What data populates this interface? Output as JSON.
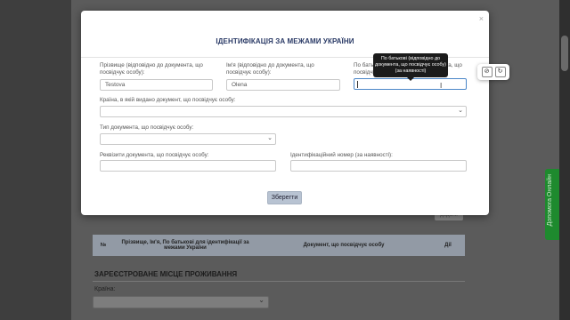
{
  "modal": {
    "title": "ІДЕНТИФІКАЦІЯ ЗА МЕЖАМИ УКРАЇНИ",
    "close_label": "×",
    "fields": {
      "surname": {
        "label": "Прізвище (відповідно до документа, що посвідчує особу):",
        "value": "Testova"
      },
      "name": {
        "label": "Ім'я (відповідно до документа, що посвідчує особу):",
        "value": "Olena"
      },
      "patronymic": {
        "label": "По батькові (відповідно до документа, що посвідчує особу):",
        "value": ""
      },
      "country": {
        "label": "Країна, в якій видано документ, що посвідчує особу:",
        "value": ""
      },
      "doc_type": {
        "label": "Тип документа, що посвідчує особу:",
        "value": ""
      },
      "doc_details": {
        "label": "Реквізити документа, що посвідчує особу:",
        "value": ""
      },
      "id_number": {
        "label": "Ідентифікаційний номер (за наявності):",
        "value": ""
      }
    },
    "save_label": "Зберегти"
  },
  "tooltip": {
    "line1": "По батькові (відповідно до",
    "line2": "документа, що посвідчує особу)",
    "line3": "(за наявності)"
  },
  "background": {
    "under_text": "— — — —  —  — — —",
    "under_button": "додати",
    "table": {
      "headers": [
        "№",
        "Прізвище, Ім'я, По батькові для ідентифікації за межами України",
        "Документ, що посвідчує особу",
        "Дії"
      ]
    },
    "section_title": "ЗАРЕЄСТРОВАНЕ МІСЦЕ ПРОЖИВАННЯ",
    "country_label": "Країна:",
    "feedback_label": "Допомога Онлайн"
  },
  "icons": {
    "close": "close-icon",
    "caret": "text-caret",
    "select_arrow": "chevron-down-icon",
    "tool_1": "block-icon",
    "tool_2": "refresh-icon",
    "cursor": "i-beam-cursor-icon"
  }
}
